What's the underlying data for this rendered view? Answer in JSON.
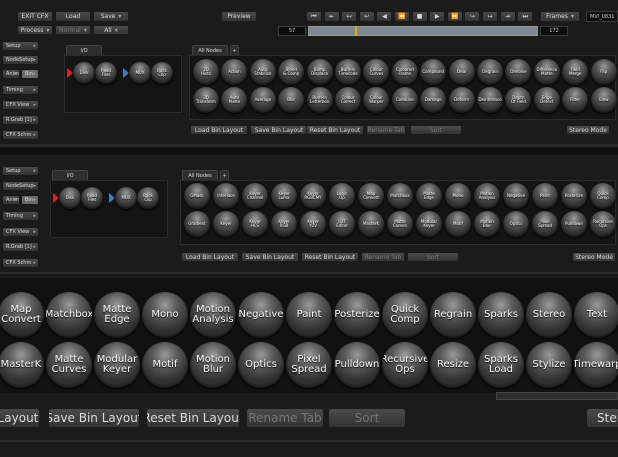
{
  "top_toolbar": {
    "exit_label": "EXIT CFX",
    "load_label": "Load",
    "save_label": "Save",
    "process_label": "Process",
    "normal_label": "Normal",
    "all_label": "All",
    "preview_label": "Preview",
    "frames_label": "Frames",
    "clip_name": "MVI_0831",
    "frame_start": "57",
    "frame_end": "172",
    "timeline_progress": 0.2
  },
  "side_menu": {
    "setup": "Setup",
    "nodesetup": "NodeSetup",
    "anim": "Anim",
    "bin": "Bin",
    "timing": "Timing",
    "cfx_view": "CFX View",
    "rgrab": "R.Grab [1]",
    "cfx_schm": "CFX Schm"
  },
  "bin_panel_1": {
    "io_tab": "I/O",
    "io_items": [
      "Disk",
      "Read Files",
      "MUX",
      "Back Clip"
    ],
    "all_nodes_tab": "All Nodes",
    "plus_tab": "+",
    "row1": [
      "2D Histo",
      "Action",
      "Auto Stabilize",
      "Blend & Comp",
      "Bump Displace",
      "Burn-In Timecode",
      "Colour Curves",
      "Coloured Frame",
      "Compound",
      "Deal",
      "Degrain",
      "Denoise",
      "Difference Matte",
      "Field Merge",
      "Flip"
    ],
    "row2": [
      "3D Transform",
      "Auto Matte",
      "Average",
      "Blur",
      "Burn-In Letterbox",
      "Colour Correct",
      "Colour Warper",
      "Combine",
      "Damage",
      "Deform",
      "Deinterlace",
      "Depth Of Field",
      "Edge Detect",
      "Filter",
      "Glow"
    ],
    "load_bin": "Load Bin Layout",
    "save_bin": "Save Bin Layout",
    "reset_bin": "Reset Bin Layout",
    "rename_tab": "Rename Tab",
    "sort": "Sort",
    "stereo_mode": "Stereo Mode"
  },
  "bin_panel_2": {
    "io_tab": "I/O",
    "io_items": [
      "Disk",
      "Read Files",
      "MUX",
      "Back Clip"
    ],
    "all_nodes_tab": "All Nodes",
    "plus_tab": "+",
    "row1": [
      "GMask",
      "Interlace",
      "Keyer Channel",
      "Keyer Luma",
      "Keyer RGBCMY",
      "Logic Op",
      "Map Convert",
      "Matchbox",
      "Matte Edge",
      "Mono",
      "Motion Analysis",
      "Negative",
      "Paint",
      "Posterize",
      "Quick Comp"
    ],
    "row2": [
      "Gradient",
      "Keyer",
      "Keyer HLS",
      "Keyer RGB",
      "Keyer YUV",
      "LUT Editor",
      "MasterK",
      "Matte Curves",
      "Modular Keyer",
      "Motif",
      "Motion Blur",
      "Optics",
      "Pixel Spread",
      "Pulldown",
      "Recursive Ops"
    ],
    "load_bin": "Load Bin Layout",
    "save_bin": "Save Bin Layout",
    "reset_bin": "Reset Bin Layout",
    "rename_tab": "Rename Tab",
    "sort": "Sort",
    "stereo_mode": "Stereo Mode"
  },
  "zoom_panel": {
    "row1": [
      "Map Convert",
      "Matchbox",
      "Matte Edge",
      "Mono",
      "Motion Analysis",
      "Negative",
      "Paint",
      "Posterize",
      "Quick Comp",
      "Regrain",
      "Sparks",
      "Stereo",
      "Text"
    ],
    "row2": [
      "MasterK",
      "Matte Curves",
      "Modular Keyer",
      "Motif",
      "Motion Blur",
      "Optics",
      "Pixel Spread",
      "Pulldown",
      "Recursive Ops",
      "Resize",
      "Sparks Load",
      "Stylize",
      "Timewarp"
    ],
    "layout_label": "Layout",
    "save_bin": "Save Bin Layout",
    "reset_bin": "Reset Bin Layout",
    "rename_tab": "Rename Tab",
    "sort": "Sort",
    "stereo_label": "Stere"
  },
  "colors": {
    "background": "#1b1b1b",
    "panel": "#141414",
    "disk_arrow": "#dd2222",
    "mux_arrow": "#3a7bd5",
    "timeline": "#7f8794",
    "playhead": "#e0b000"
  }
}
